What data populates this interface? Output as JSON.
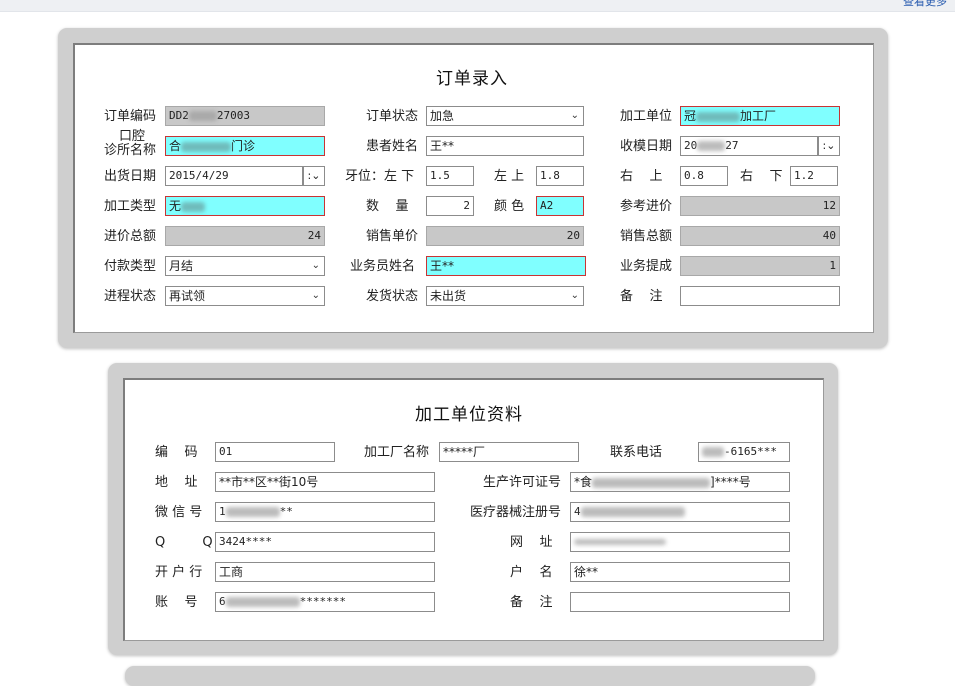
{
  "page": {
    "top_link": "查看更多"
  },
  "order": {
    "title": "订单录入",
    "labels": {
      "order_no": "订单编码",
      "order_status": "订单状态",
      "processor": "加工单位",
      "clinic_line1": "口腔",
      "clinic_line2": "诊所名称",
      "patient": "患者姓名",
      "mold_date": "收模日期",
      "ship_date": "出货日期",
      "tooth_lower": "牙位：左 下",
      "tooth_left_upper": "左 上",
      "tooth_right_upper": "右    上",
      "tooth_right_lower": "右    下",
      "type": "加工类型",
      "quantity": "数    量",
      "color": "颜 色",
      "ref_price": "参考进价",
      "cost_total": "进价总额",
      "sale_price": "销售单价",
      "sale_total": "销售总额",
      "pay_type": "付款类型",
      "salesman": "业务员姓名",
      "commission": "业务提成",
      "progress": "进程状态",
      "ship_status": "发货状态",
      "remark": "备    注"
    },
    "values": {
      "order_no_a": "DD2",
      "order_no_b": "27003",
      "order_status": "加急",
      "processor_a": "冠",
      "processor_b": "加工厂",
      "clinic_a": "合",
      "clinic_b": "门诊",
      "patient": "王**",
      "mold_date_a": "20",
      "mold_date_b": "27",
      "ship_date": "2015/4/29",
      "tooth_lower": "1.5",
      "tooth_left_upper": "1.8",
      "tooth_right_upper": "0.8",
      "tooth_right_lower": "1.2",
      "type": "无",
      "quantity": "2",
      "color": "A2",
      "ref_price": "12",
      "cost_total": "24",
      "sale_price": "20",
      "sale_total": "40",
      "pay_type": "月结",
      "salesman": "王**",
      "commission": "1",
      "progress": "再试领",
      "ship_status": "未出货",
      "remark": ""
    }
  },
  "factory": {
    "title": "加工单位资料",
    "labels": {
      "code": "编    码",
      "name": "加工厂名称",
      "phone": "联系电话",
      "address": "地    址",
      "license": "生产许可证号",
      "wechat": "微 信 号",
      "device_reg": "医疗器械注册号",
      "qq": "Q         Q",
      "website": "网    址",
      "bank": "开 户 行",
      "account_name": "户    名",
      "account_no": "账    号",
      "remark": "备    注"
    },
    "values": {
      "code": "01",
      "name": "*****厂",
      "phone_b": "-6165***",
      "address": "**市**区**街10号",
      "license_a": "*食",
      "license_b": "]****号",
      "wechat_a": "1",
      "wechat_b": "**",
      "device_reg_a": "4",
      "qq": "3424****",
      "website": "",
      "bank": "工商",
      "account_name": "徐**",
      "account_no_a": "6",
      "account_no_b": "*******",
      "remark": ""
    }
  }
}
